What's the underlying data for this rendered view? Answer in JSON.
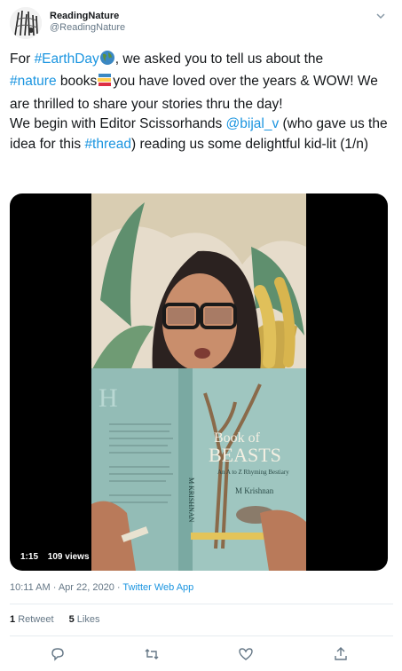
{
  "account": {
    "display_name": "ReadingNature",
    "handle": "@ReadingNature"
  },
  "tweet": {
    "line1_pre": "For ",
    "hashtag_earthday": "#EarthDay",
    "line1_post": ", we asked you to tell us about the",
    "hashtag_nature": "#nature",
    "line2_mid": " books",
    "line2_post": "you have loved over the years & WOW! We are thrilled to share your stories thru the day!",
    "para2_pre": "We begin with Editor Scissorhands ",
    "mention": "@bijal_v",
    "para2_mid": " (who gave us the idea for this ",
    "hashtag_thread": "#thread",
    "para2_post": ") reading us some delightful kid-lit (1/n)"
  },
  "media": {
    "duration": "1:15",
    "views": "109 views",
    "book": {
      "title_line1": "Book of",
      "title_line2": "BEASTS",
      "subtitle": "An A to Z Rhyming Bestiary",
      "author": "M Krishnan",
      "spine_text": "M KRISHNAN"
    }
  },
  "meta": {
    "timestamp": "10:11 AM · Apr 22, 2020 · ",
    "source": "Twitter Web App"
  },
  "stats": {
    "retweets_count": "1",
    "retweets_label": "Retweet",
    "likes_count": "5",
    "likes_label": "Likes"
  },
  "colors": {
    "link": "#1b95e0",
    "text": "#14171a",
    "muted": "#657786",
    "book_cover": "#9fc6c0"
  },
  "icons": [
    "caret-down-icon",
    "earth-globe-emoji",
    "books-emoji",
    "reply-icon",
    "retweet-icon",
    "like-icon",
    "share-icon"
  ]
}
